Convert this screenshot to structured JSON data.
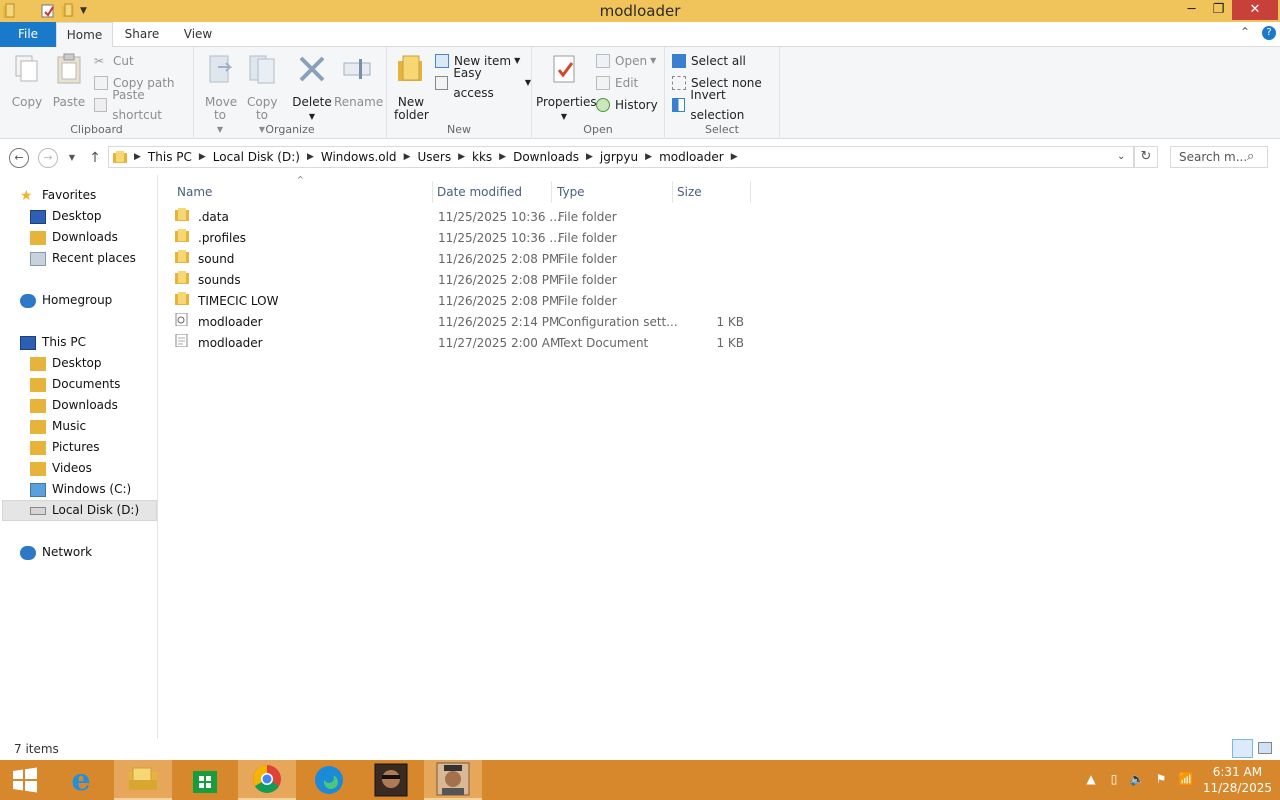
{
  "window": {
    "title": "modloader"
  },
  "titlebar": {
    "minimize_icon": "minimize-icon",
    "maximize_icon": "maximize-icon",
    "close_icon": "close-icon"
  },
  "ribbon_tabs": {
    "file": "File",
    "home": "Home",
    "share": "Share",
    "view": "View"
  },
  "ribbon": {
    "clipboard": {
      "label": "Clipboard",
      "copy": "Copy",
      "paste": "Paste",
      "cut": "Cut",
      "copy_path": "Copy path",
      "paste_shortcut": "Paste shortcut"
    },
    "organize": {
      "label": "Organize",
      "move_to": "Move to",
      "copy_to": "Copy to",
      "delete": "Delete",
      "rename": "Rename"
    },
    "new": {
      "label": "New",
      "new_folder": "New folder",
      "new_item": "New item",
      "easy_access": "Easy access"
    },
    "open": {
      "label": "Open",
      "properties": "Properties",
      "open": "Open",
      "edit": "Edit",
      "history": "History"
    },
    "select": {
      "label": "Select",
      "select_all": "Select all",
      "select_none": "Select none",
      "invert_selection": "Invert selection"
    }
  },
  "address": {
    "crumbs": [
      "This PC",
      "Local Disk (D:)",
      "Windows.old",
      "Users",
      "kks",
      "Downloads",
      "jgrpyu",
      "modloader"
    ],
    "search_placeholder": "Search m..."
  },
  "nav": {
    "favorites": "Favorites",
    "fav_items": [
      "Desktop",
      "Downloads",
      "Recent places"
    ],
    "homegroup": "Homegroup",
    "this_pc": "This PC",
    "pc_items": [
      "Desktop",
      "Documents",
      "Downloads",
      "Music",
      "Pictures",
      "Videos",
      "Windows (C:)",
      "Local Disk (D:)"
    ],
    "network": "Network"
  },
  "columns": {
    "name": "Name",
    "date": "Date modified",
    "type": "Type",
    "size": "Size"
  },
  "files": [
    {
      "name": ".data",
      "date": "11/25/2025 10:36 ...",
      "type": "File folder",
      "size": "",
      "icon": "folder-icon"
    },
    {
      "name": ".profiles",
      "date": "11/25/2025 10:36 ...",
      "type": "File folder",
      "size": "",
      "icon": "folder-icon"
    },
    {
      "name": "sound",
      "date": "11/26/2025 2:08 PM",
      "type": "File folder",
      "size": "",
      "icon": "folder-icon"
    },
    {
      "name": "sounds",
      "date": "11/26/2025 2:08 PM",
      "type": "File folder",
      "size": "",
      "icon": "folder-icon"
    },
    {
      "name": "TIMECIC LOW",
      "date": "11/26/2025 2:08 PM",
      "type": "File folder",
      "size": "",
      "icon": "folder-icon"
    },
    {
      "name": "modloader",
      "date": "11/26/2025 2:14 PM",
      "type": "Configuration sett...",
      "size": "1 KB",
      "icon": "config-file-icon"
    },
    {
      "name": "modloader",
      "date": "11/27/2025 2:00 AM",
      "type": "Text Document",
      "size": "1 KB",
      "icon": "text-file-icon"
    }
  ],
  "status": {
    "items": "7 items"
  },
  "clock": {
    "time": "6:31 AM",
    "date": "11/28/2025"
  },
  "colors": {
    "titlebar": "#f0c45a",
    "file_tab": "#1979ca",
    "taskbar": "#d7882c",
    "close": "#c7403a"
  }
}
